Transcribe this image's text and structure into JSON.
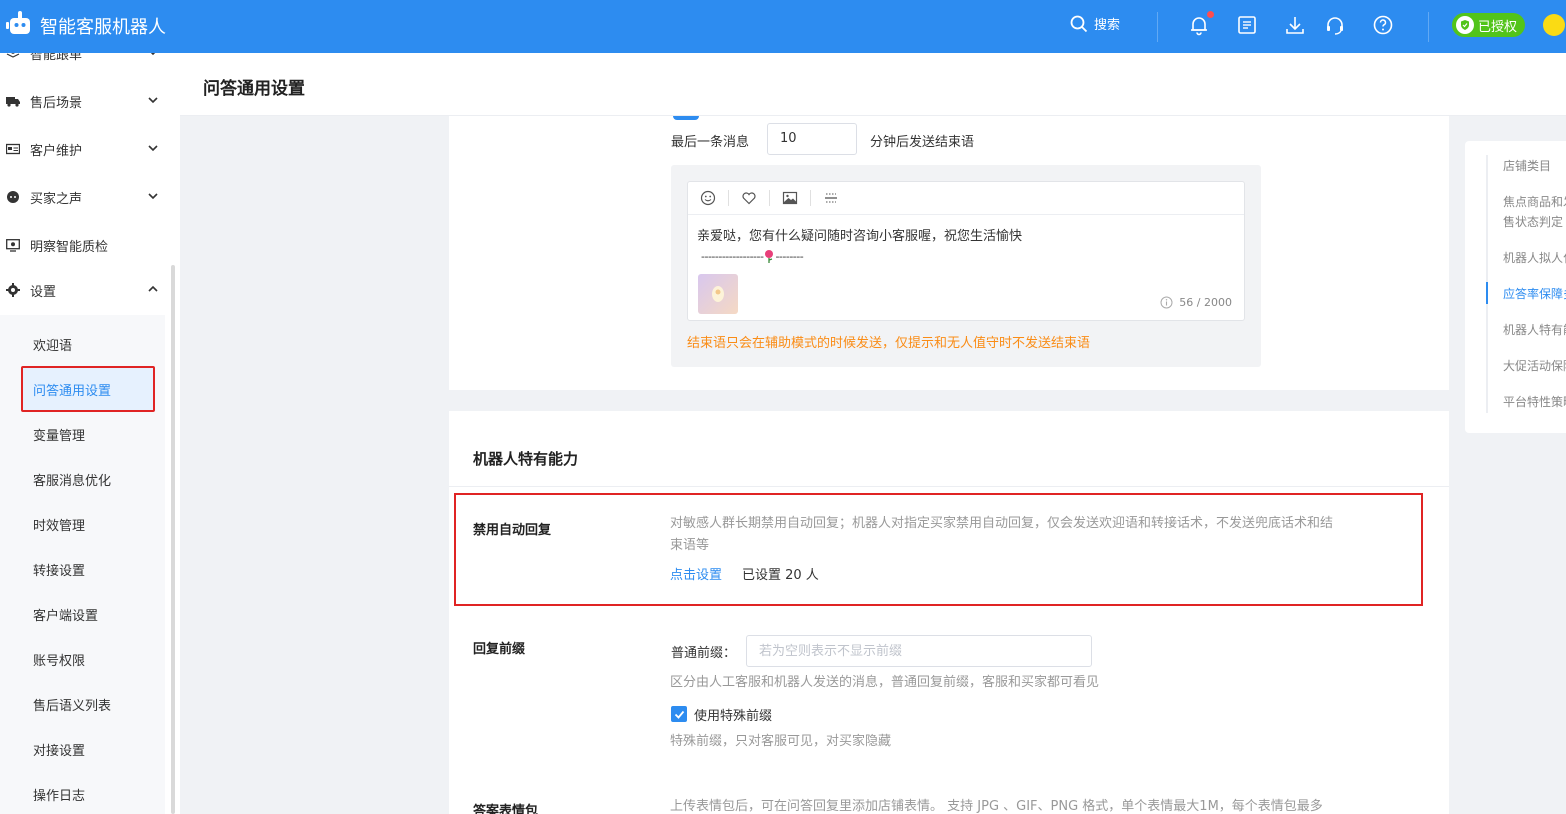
{
  "app": {
    "title": "智能客服机器人"
  },
  "topbar": {
    "search_label": "搜索",
    "auth_label": "已授权",
    "icons": [
      "search-icon",
      "bell-icon",
      "document-icon",
      "download-icon",
      "headset-icon",
      "help-icon",
      "shield-check-icon",
      "vip-icon"
    ]
  },
  "sidebar": {
    "items": [
      {
        "label": "智能跟单",
        "icon": "layers-icon"
      },
      {
        "label": "售后场景",
        "icon": "truck-icon"
      },
      {
        "label": "客户维护",
        "icon": "card-icon"
      },
      {
        "label": "买家之声",
        "icon": "chat-icon"
      },
      {
        "label": "明察智能质检",
        "icon": "monitor-icon"
      },
      {
        "label": "设置",
        "icon": "gear-icon"
      }
    ],
    "sub_items": [
      "欢迎语",
      "问答通用设置",
      "变量管理",
      "客服消息优化",
      "时效管理",
      "转接设置",
      "客户端设置",
      "账号权限",
      "售后语义列表",
      "对接设置",
      "操作日志"
    ],
    "active_sub": "问答通用设置"
  },
  "page": {
    "title": "问答通用设置"
  },
  "end_message": {
    "label_before": "最后一条消息",
    "minutes_value": "10",
    "label_after": "分钟后发送结束语",
    "editor_text": "亲爱哒，您有什么疑问随时咨询小客服喔，祝您生活愉快",
    "editor_line_left": "------------------",
    "editor_line_right": "--------",
    "char_count": "56 / 2000",
    "warning": "结束语只会在辅助模式的时候发送，仅提示和无人值守时不发送结束语"
  },
  "robot_section": {
    "title": "机器人特有能力",
    "disable_auto_reply": {
      "label": "禁用自动回复",
      "desc_line1": "对敏感人群长期禁用自动回复；机器人对指定买家禁用自动回复，仅会发送欢迎语和转接话术，不发送兜底话术和结",
      "desc_line2": "束语等",
      "link": "点击设置",
      "set_count": "已设置 20 人"
    },
    "reply_prefix": {
      "label": "回复前缀",
      "normal_label": "普通前缀：",
      "normal_placeholder": "若为空则表示不显示前缀",
      "normal_desc": "区分由人工客服和机器人发送的消息，普通回复前缀，客服和买家都可看见",
      "special_checkbox_label": "使用特殊前缀",
      "special_checked": true,
      "special_desc": "特殊前缀，只对客服可见，对买家隐藏"
    },
    "sticker": {
      "label": "答案表情包",
      "desc": "上传表情包后，可在问答回复里添加店铺表情。 支持 JPG 、GIF、PNG 格式，单个表情最大1M，每个表情包最多"
    }
  },
  "anchors": {
    "items": [
      "店铺类目",
      "焦点商品和发",
      "售状态判定",
      "机器人拟人化",
      "应答率保障多",
      "机器人特有能",
      "大促活动保障",
      "平台特性策略"
    ],
    "active": "应答率保障多"
  },
  "colors": {
    "primary": "#2d8cf0",
    "warning": "#fa8c16",
    "highlight_border": "#e02424",
    "auth_green": "#52c41a"
  }
}
